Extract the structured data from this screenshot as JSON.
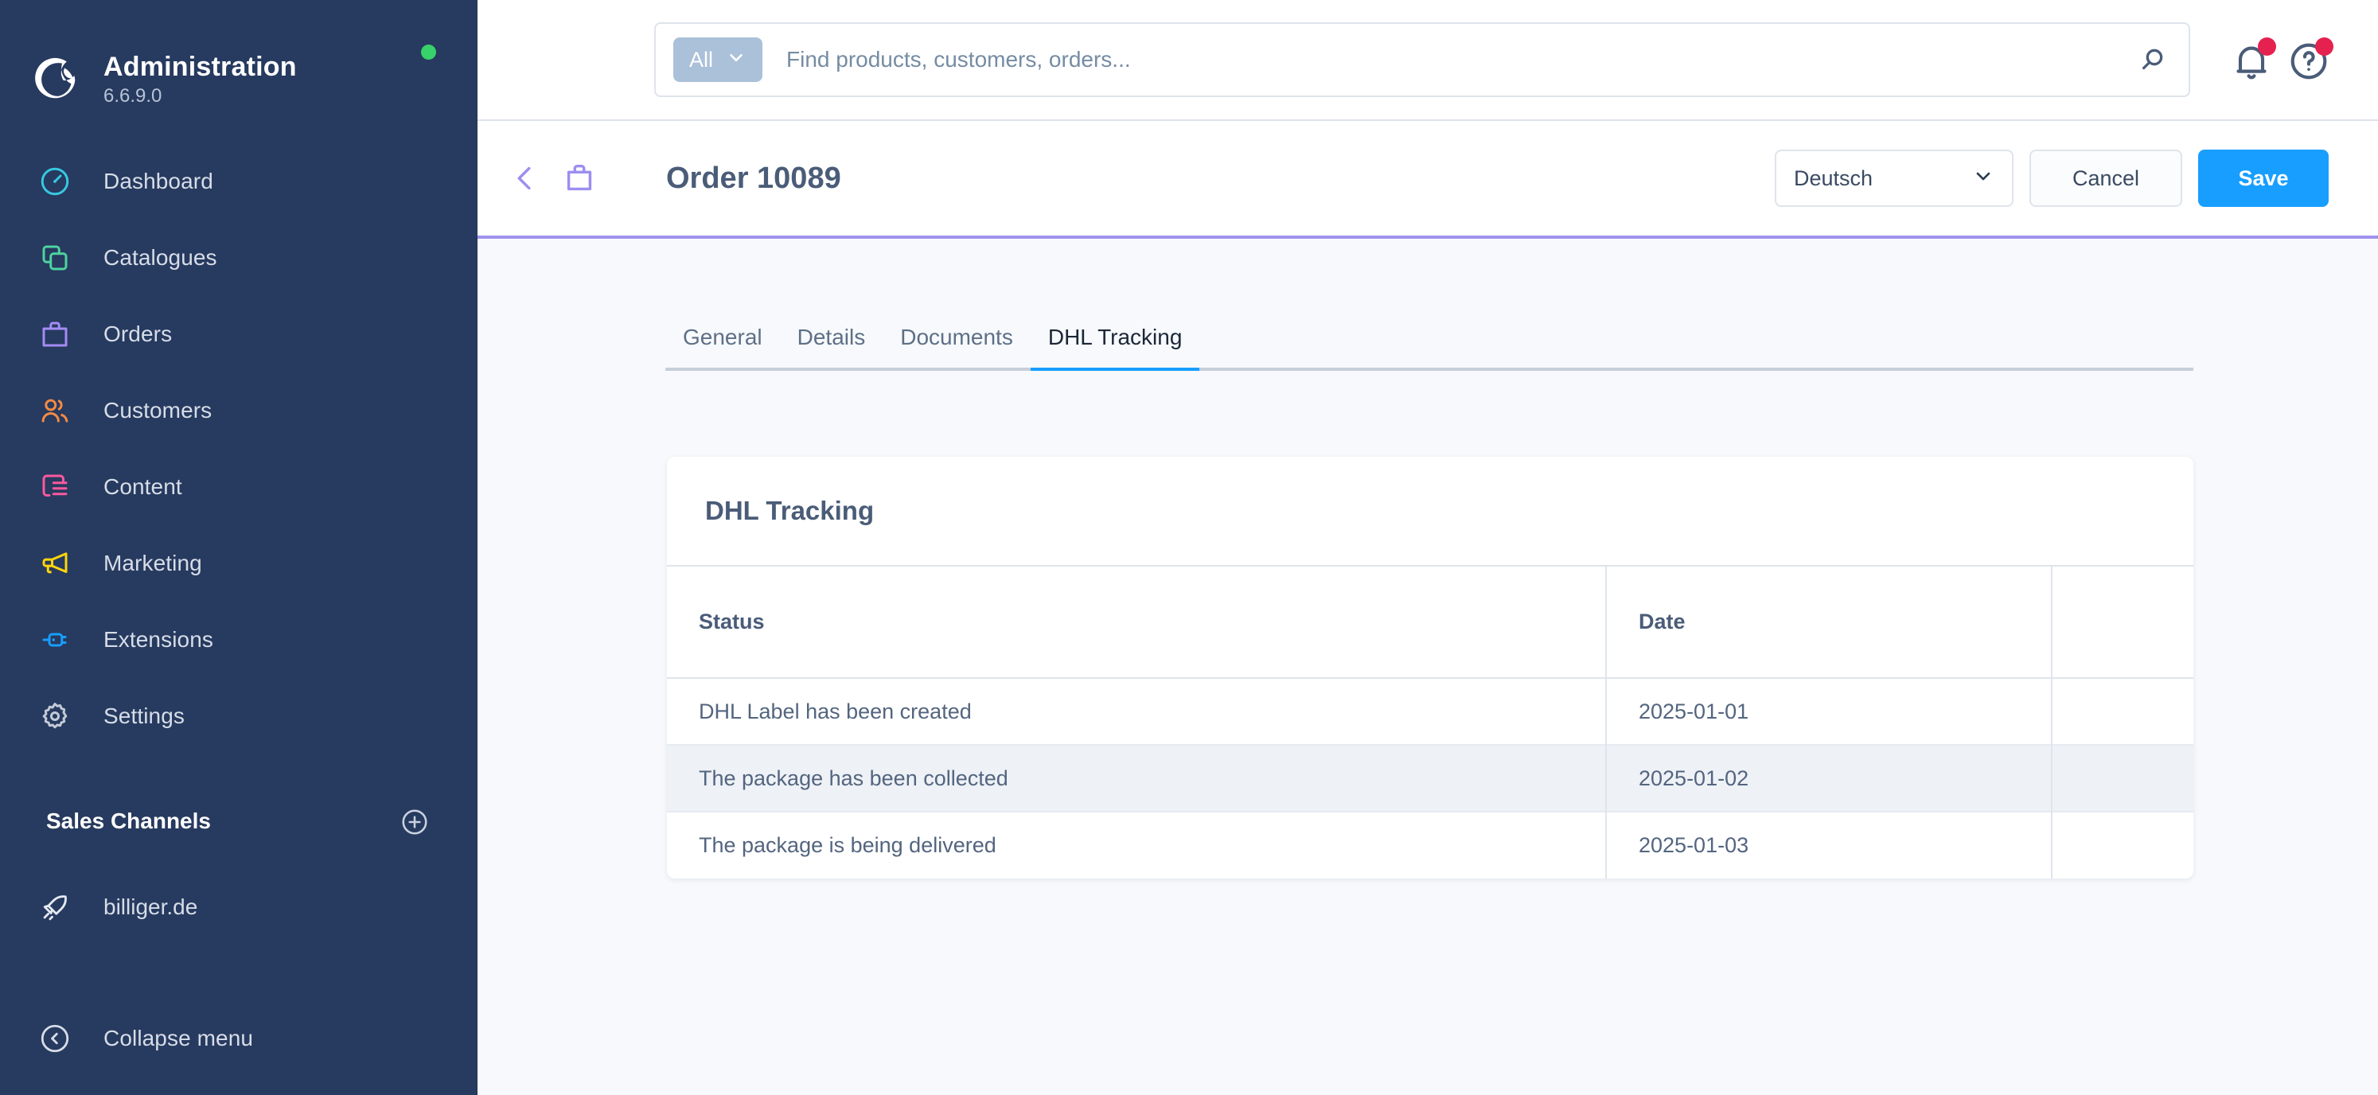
{
  "sidebar": {
    "brand": {
      "title": "Administration",
      "version": "6.6.9.0",
      "status_color": "#37d26a"
    },
    "items": [
      {
        "label": "Dashboard",
        "icon": "dashboard-icon",
        "color": "#36c9e0"
      },
      {
        "label": "Catalogues",
        "icon": "catalogues-icon",
        "color": "#4dd4a0"
      },
      {
        "label": "Orders",
        "icon": "orders-icon",
        "color": "#a58bf5"
      },
      {
        "label": "Customers",
        "icon": "customers-icon",
        "color": "#f58a43"
      },
      {
        "label": "Content",
        "icon": "content-icon",
        "color": "#f95a9d"
      },
      {
        "label": "Marketing",
        "icon": "marketing-icon",
        "color": "#ffd60a"
      },
      {
        "label": "Extensions",
        "icon": "extensions-icon",
        "color": "#189eff"
      },
      {
        "label": "Settings",
        "icon": "settings-icon",
        "color": "#c2cad6"
      }
    ],
    "sales_channels": {
      "title": "Sales Channels",
      "add_icon": "plus-circle-icon",
      "channels": [
        {
          "label": "billiger.de",
          "icon": "rocket-icon"
        }
      ]
    },
    "collapse": {
      "label": "Collapse menu",
      "icon": "chevron-left-circle-icon"
    }
  },
  "topbar": {
    "search": {
      "scope_label": "All",
      "scope_chevron": "chevron-down-icon",
      "placeholder": "Find products, customers, orders...",
      "value": "",
      "submit_icon": "search-icon"
    },
    "notifications_icon": "bell-icon",
    "help_icon": "question-circle-icon",
    "badge_color": "#e5214f"
  },
  "page_header": {
    "back_icon": "chevron-left-icon",
    "entity_icon": "bag-icon",
    "title": "Order 10089",
    "language": {
      "value": "Deutsch",
      "chevron": "chevron-down-icon"
    },
    "cancel_label": "Cancel",
    "save_label": "Save",
    "accent_color": "#189eff",
    "header_border_color": "#a092f0"
  },
  "main": {
    "tabs": [
      {
        "label": "General",
        "active": false
      },
      {
        "label": "Details",
        "active": false
      },
      {
        "label": "Documents",
        "active": false
      },
      {
        "label": "DHL Tracking",
        "active": true
      }
    ],
    "card": {
      "title": "DHL Tracking",
      "table": {
        "columns": [
          "Status",
          "Date",
          ""
        ],
        "rows": [
          {
            "status": "DHL Label has been created",
            "date": "2025-01-01",
            "action": "",
            "hovered": false
          },
          {
            "status": "The package has been collected",
            "date": "2025-01-02",
            "action": "",
            "hovered": true
          },
          {
            "status": "The package is being delivered",
            "date": "2025-01-03",
            "action": "",
            "hovered": false
          }
        ]
      }
    }
  }
}
